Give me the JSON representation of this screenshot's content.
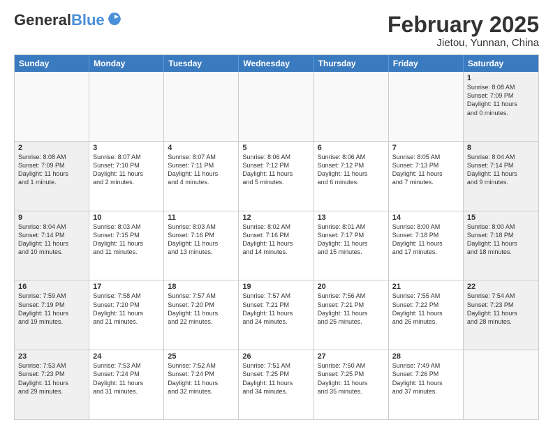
{
  "logo": {
    "general": "General",
    "blue": "Blue"
  },
  "header": {
    "title": "February 2025",
    "location": "Jietou, Yunnan, China"
  },
  "day_headers": [
    "Sunday",
    "Monday",
    "Tuesday",
    "Wednesday",
    "Thursday",
    "Friday",
    "Saturday"
  ],
  "weeks": [
    [
      {
        "num": "",
        "info": "",
        "empty": true
      },
      {
        "num": "",
        "info": "",
        "empty": true
      },
      {
        "num": "",
        "info": "",
        "empty": true
      },
      {
        "num": "",
        "info": "",
        "empty": true
      },
      {
        "num": "",
        "info": "",
        "empty": true
      },
      {
        "num": "",
        "info": "",
        "empty": true
      },
      {
        "num": "1",
        "info": "Sunrise: 8:08 AM\nSunset: 7:09 PM\nDaylight: 11 hours\nand 0 minutes.",
        "weekend": true
      }
    ],
    [
      {
        "num": "2",
        "info": "Sunrise: 8:08 AM\nSunset: 7:09 PM\nDaylight: 11 hours\nand 1 minute.",
        "weekend": true
      },
      {
        "num": "3",
        "info": "Sunrise: 8:07 AM\nSunset: 7:10 PM\nDaylight: 11 hours\nand 2 minutes.",
        "weekend": false
      },
      {
        "num": "4",
        "info": "Sunrise: 8:07 AM\nSunset: 7:11 PM\nDaylight: 11 hours\nand 4 minutes.",
        "weekend": false
      },
      {
        "num": "5",
        "info": "Sunrise: 8:06 AM\nSunset: 7:12 PM\nDaylight: 11 hours\nand 5 minutes.",
        "weekend": false
      },
      {
        "num": "6",
        "info": "Sunrise: 8:06 AM\nSunset: 7:12 PM\nDaylight: 11 hours\nand 6 minutes.",
        "weekend": false
      },
      {
        "num": "7",
        "info": "Sunrise: 8:05 AM\nSunset: 7:13 PM\nDaylight: 11 hours\nand 7 minutes.",
        "weekend": false
      },
      {
        "num": "8",
        "info": "Sunrise: 8:04 AM\nSunset: 7:14 PM\nDaylight: 11 hours\nand 9 minutes.",
        "weekend": true
      }
    ],
    [
      {
        "num": "9",
        "info": "Sunrise: 8:04 AM\nSunset: 7:14 PM\nDaylight: 11 hours\nand 10 minutes.",
        "weekend": true
      },
      {
        "num": "10",
        "info": "Sunrise: 8:03 AM\nSunset: 7:15 PM\nDaylight: 11 hours\nand 11 minutes.",
        "weekend": false
      },
      {
        "num": "11",
        "info": "Sunrise: 8:03 AM\nSunset: 7:16 PM\nDaylight: 11 hours\nand 13 minutes.",
        "weekend": false
      },
      {
        "num": "12",
        "info": "Sunrise: 8:02 AM\nSunset: 7:16 PM\nDaylight: 11 hours\nand 14 minutes.",
        "weekend": false
      },
      {
        "num": "13",
        "info": "Sunrise: 8:01 AM\nSunset: 7:17 PM\nDaylight: 11 hours\nand 15 minutes.",
        "weekend": false
      },
      {
        "num": "14",
        "info": "Sunrise: 8:00 AM\nSunset: 7:18 PM\nDaylight: 11 hours\nand 17 minutes.",
        "weekend": false
      },
      {
        "num": "15",
        "info": "Sunrise: 8:00 AM\nSunset: 7:18 PM\nDaylight: 11 hours\nand 18 minutes.",
        "weekend": true
      }
    ],
    [
      {
        "num": "16",
        "info": "Sunrise: 7:59 AM\nSunset: 7:19 PM\nDaylight: 11 hours\nand 19 minutes.",
        "weekend": true
      },
      {
        "num": "17",
        "info": "Sunrise: 7:58 AM\nSunset: 7:20 PM\nDaylight: 11 hours\nand 21 minutes.",
        "weekend": false
      },
      {
        "num": "18",
        "info": "Sunrise: 7:57 AM\nSunset: 7:20 PM\nDaylight: 11 hours\nand 22 minutes.",
        "weekend": false
      },
      {
        "num": "19",
        "info": "Sunrise: 7:57 AM\nSunset: 7:21 PM\nDaylight: 11 hours\nand 24 minutes.",
        "weekend": false
      },
      {
        "num": "20",
        "info": "Sunrise: 7:56 AM\nSunset: 7:21 PM\nDaylight: 11 hours\nand 25 minutes.",
        "weekend": false
      },
      {
        "num": "21",
        "info": "Sunrise: 7:55 AM\nSunset: 7:22 PM\nDaylight: 11 hours\nand 26 minutes.",
        "weekend": false
      },
      {
        "num": "22",
        "info": "Sunrise: 7:54 AM\nSunset: 7:23 PM\nDaylight: 11 hours\nand 28 minutes.",
        "weekend": true
      }
    ],
    [
      {
        "num": "23",
        "info": "Sunrise: 7:53 AM\nSunset: 7:23 PM\nDaylight: 11 hours\nand 29 minutes.",
        "weekend": true
      },
      {
        "num": "24",
        "info": "Sunrise: 7:53 AM\nSunset: 7:24 PM\nDaylight: 11 hours\nand 31 minutes.",
        "weekend": false
      },
      {
        "num": "25",
        "info": "Sunrise: 7:52 AM\nSunset: 7:24 PM\nDaylight: 11 hours\nand 32 minutes.",
        "weekend": false
      },
      {
        "num": "26",
        "info": "Sunrise: 7:51 AM\nSunset: 7:25 PM\nDaylight: 11 hours\nand 34 minutes.",
        "weekend": false
      },
      {
        "num": "27",
        "info": "Sunrise: 7:50 AM\nSunset: 7:25 PM\nDaylight: 11 hours\nand 35 minutes.",
        "weekend": false
      },
      {
        "num": "28",
        "info": "Sunrise: 7:49 AM\nSunset: 7:26 PM\nDaylight: 11 hours\nand 37 minutes.",
        "weekend": false
      },
      {
        "num": "",
        "info": "",
        "empty": true
      }
    ]
  ]
}
